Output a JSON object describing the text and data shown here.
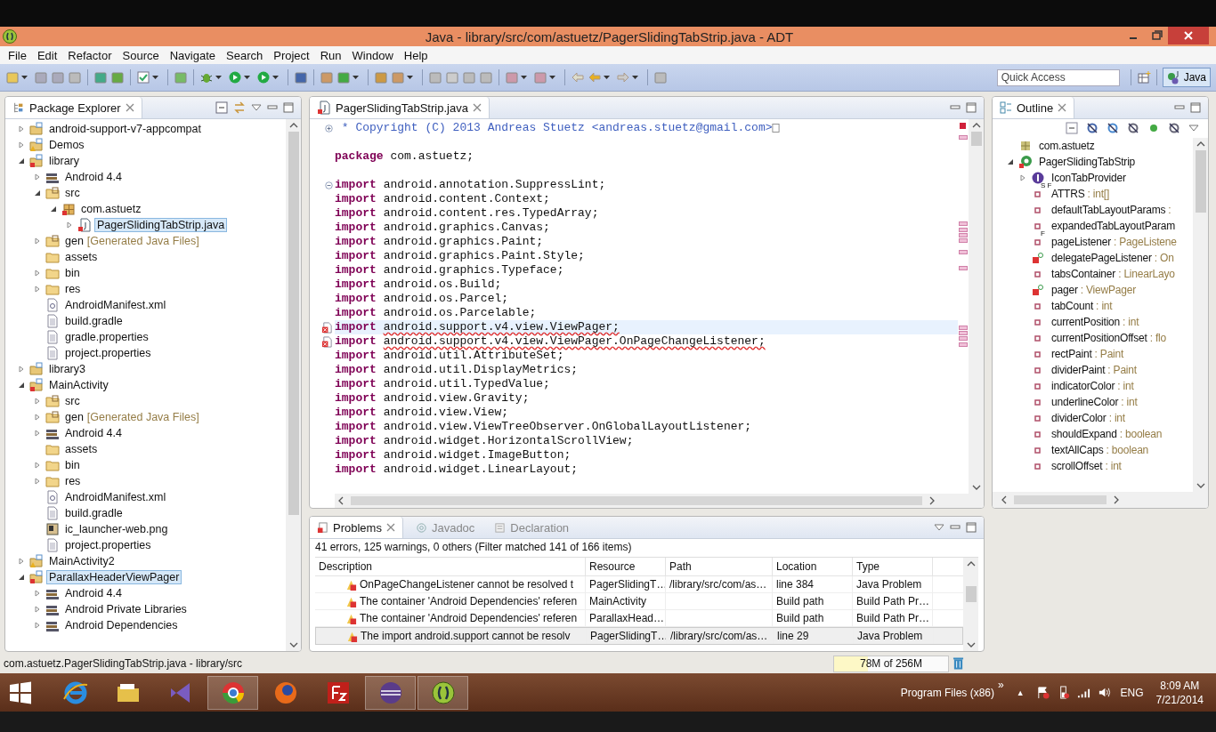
{
  "window": {
    "title": "Java - library/src/com/astuetz/PagerSlidingTabStrip.java - ADT"
  },
  "menu": [
    "File",
    "Edit",
    "Refactor",
    "Source",
    "Navigate",
    "Search",
    "Project",
    "Run",
    "Window",
    "Help"
  ],
  "quick_access": {
    "placeholder": "Quick Access"
  },
  "perspective": {
    "label": "Java",
    "selected": true
  },
  "package_explorer": {
    "title": "Package Explorer",
    "items": [
      {
        "label": "android-support-v7-appcompat",
        "kind": "project",
        "expanded": false,
        "selected": false
      },
      {
        "label": "Demos",
        "kind": "project-warn",
        "expanded": false,
        "selected": false
      },
      {
        "label": "library",
        "kind": "project-error",
        "expanded": true,
        "selected": false,
        "children": [
          {
            "label": "Android 4.4",
            "kind": "library",
            "expanded": false,
            "selected": false
          },
          {
            "label": "src",
            "kind": "source-folder",
            "expanded": true,
            "selected": false,
            "children": [
              {
                "label": "com.astuetz",
                "kind": "package",
                "expanded": true,
                "selected": false,
                "children": [
                  {
                    "label": "PagerSlidingTabStrip.java",
                    "kind": "java",
                    "expanded": false,
                    "selected": true
                  }
                ]
              }
            ]
          },
          {
            "label": "gen",
            "suffix": "[Generated Java Files]",
            "kind": "source-folder",
            "expanded": false,
            "selected": false
          },
          {
            "label": "assets",
            "kind": "folder",
            "selected": false
          },
          {
            "label": "bin",
            "kind": "folder",
            "expanded": false,
            "selected": false
          },
          {
            "label": "res",
            "kind": "folder",
            "expanded": false,
            "selected": false
          },
          {
            "label": "AndroidManifest.xml",
            "kind": "xml",
            "selected": false
          },
          {
            "label": "build.gradle",
            "kind": "file",
            "selected": false
          },
          {
            "label": "gradle.properties",
            "kind": "file",
            "selected": false
          },
          {
            "label": "project.properties",
            "kind": "file",
            "selected": false
          }
        ]
      },
      {
        "label": "library3",
        "kind": "project",
        "expanded": false,
        "selected": false
      },
      {
        "label": "MainActivity",
        "kind": "project-error",
        "expanded": true,
        "selected": false,
        "children": [
          {
            "label": "src",
            "kind": "source-folder",
            "expanded": false,
            "selected": false
          },
          {
            "label": "gen",
            "suffix": "[Generated Java Files]",
            "kind": "source-folder",
            "expanded": false,
            "selected": false
          },
          {
            "label": "Android 4.4",
            "kind": "library",
            "expanded": false,
            "selected": false
          },
          {
            "label": "assets",
            "kind": "folder",
            "selected": false
          },
          {
            "label": "bin",
            "kind": "folder",
            "expanded": false,
            "selected": false
          },
          {
            "label": "res",
            "kind": "folder",
            "expanded": false,
            "selected": false
          },
          {
            "label": "AndroidManifest.xml",
            "kind": "xml",
            "selected": false
          },
          {
            "label": "build.gradle",
            "kind": "file",
            "selected": false
          },
          {
            "label": "ic_launcher-web.png",
            "kind": "image",
            "selected": false
          },
          {
            "label": "project.properties",
            "kind": "file",
            "selected": false
          }
        ]
      },
      {
        "label": "MainActivity2",
        "kind": "project-warn",
        "expanded": false,
        "selected": false
      },
      {
        "label": "ParallaxHeaderViewPager",
        "kind": "project-error",
        "expanded": true,
        "selected": true,
        "children": [
          {
            "label": "Android 4.4",
            "kind": "library",
            "expanded": false,
            "selected": false
          },
          {
            "label": "Android Private Libraries",
            "kind": "library",
            "expanded": false,
            "selected": false
          },
          {
            "label": "Android Dependencies",
            "kind": "library",
            "expanded": false,
            "selected": false
          }
        ]
      }
    ]
  },
  "editor": {
    "tab": {
      "label": "PagerSlidingTabStrip.java"
    },
    "lines": [
      {
        "kind": "comment",
        "folded": true,
        "text": " * Copyright (C) 2013 Andreas Stuetz <andreas.stuetz@gmail.com>"
      },
      {
        "kind": "blank"
      },
      {
        "kind": "statement",
        "keyword": "package",
        "text": "com.astuetz;"
      },
      {
        "kind": "blank"
      },
      {
        "kind": "statement",
        "folded": false,
        "keyword": "import",
        "text": "android.annotation.SuppressLint;"
      },
      {
        "kind": "statement",
        "keyword": "import",
        "text": "android.content.Context;"
      },
      {
        "kind": "statement",
        "keyword": "import",
        "text": "android.content.res.TypedArray;"
      },
      {
        "kind": "statement",
        "keyword": "import",
        "text": "android.graphics.Canvas;"
      },
      {
        "kind": "statement",
        "keyword": "import",
        "text": "android.graphics.Paint;"
      },
      {
        "kind": "statement",
        "keyword": "import",
        "text": "android.graphics.Paint.Style;"
      },
      {
        "kind": "statement",
        "keyword": "import",
        "text": "android.graphics.Typeface;"
      },
      {
        "kind": "statement",
        "keyword": "import",
        "text": "android.os.Build;"
      },
      {
        "kind": "statement",
        "keyword": "import",
        "text": "android.os.Parcel;"
      },
      {
        "kind": "statement",
        "keyword": "import",
        "text": "android.os.Parcelable;"
      },
      {
        "kind": "statement",
        "keyword": "import",
        "text": "android.support.v4.view.ViewPager;",
        "error": true,
        "current": true
      },
      {
        "kind": "statement",
        "keyword": "import",
        "text": "android.support.v4.view.ViewPager.OnPageChangeListener;",
        "error": true
      },
      {
        "kind": "statement",
        "keyword": "import",
        "text": "android.util.AttributeSet;"
      },
      {
        "kind": "statement",
        "keyword": "import",
        "text": "android.util.DisplayMetrics;"
      },
      {
        "kind": "statement",
        "keyword": "import",
        "text": "android.util.TypedValue;"
      },
      {
        "kind": "statement",
        "keyword": "import",
        "text": "android.view.Gravity;"
      },
      {
        "kind": "statement",
        "keyword": "import",
        "text": "android.view.View;"
      },
      {
        "kind": "statement",
        "keyword": "import",
        "text": "android.view.ViewTreeObserver.OnGlobalLayoutListener;"
      },
      {
        "kind": "statement",
        "keyword": "import",
        "text": "android.widget.HorizontalScrollView;"
      },
      {
        "kind": "statement",
        "keyword": "import",
        "text": "android.widget.ImageButton;"
      },
      {
        "kind": "statement",
        "keyword": "import",
        "text": "android.widget.LinearLayout;"
      }
    ]
  },
  "outline": {
    "title": "Outline",
    "items": [
      {
        "name": "com.astuetz",
        "kind": "package"
      },
      {
        "name": "PagerSlidingTabStrip",
        "kind": "class",
        "expanded": true,
        "children": [
          {
            "name": "IconTabProvider",
            "kind": "interface",
            "expanded": false
          },
          {
            "name": "ATTRS",
            "type": ": int[]",
            "kind": "field",
            "decorator": "S F"
          },
          {
            "name": "defaultTabLayoutParams",
            "type": ":",
            "kind": "field"
          },
          {
            "name": "expandedTabLayoutParam",
            "kind": "field"
          },
          {
            "name": "pageListener",
            "type": ": PageListene",
            "kind": "field",
            "decorator": "F"
          },
          {
            "name": "delegatePageListener",
            "type": ": On",
            "kind": "field-error"
          },
          {
            "name": "tabsContainer",
            "type": ": LinearLayo",
            "kind": "field"
          },
          {
            "name": "pager",
            "type": ": ViewPager",
            "kind": "field-error"
          },
          {
            "name": "tabCount",
            "type": ": int",
            "kind": "field"
          },
          {
            "name": "currentPosition",
            "type": ": int",
            "kind": "field"
          },
          {
            "name": "currentPositionOffset",
            "type": ": flo",
            "kind": "field"
          },
          {
            "name": "rectPaint",
            "type": ": Paint",
            "kind": "field"
          },
          {
            "name": "dividerPaint",
            "type": ": Paint",
            "kind": "field"
          },
          {
            "name": "indicatorColor",
            "type": ": int",
            "kind": "field"
          },
          {
            "name": "underlineColor",
            "type": ": int",
            "kind": "field"
          },
          {
            "name": "dividerColor",
            "type": ": int",
            "kind": "field"
          },
          {
            "name": "shouldExpand",
            "type": ": boolean",
            "kind": "field"
          },
          {
            "name": "textAllCaps",
            "type": ": boolean",
            "kind": "field"
          },
          {
            "name": "scrollOffset",
            "type": ": int",
            "kind": "field"
          }
        ]
      }
    ]
  },
  "problems": {
    "tabs": [
      {
        "label": "Problems",
        "selected": true
      },
      {
        "label": "Javadoc",
        "selected": false
      },
      {
        "label": "Declaration",
        "selected": false
      }
    ],
    "summary": "41 errors, 125 warnings, 0 others (Filter matched 141 of 166 items)",
    "columns": [
      "Description",
      "Resource",
      "Path",
      "Location",
      "Type"
    ],
    "rows": [
      {
        "description": "OnPageChangeListener cannot be resolved t",
        "resource": "PagerSlidingT…",
        "path": "/library/src/com/as…",
        "location": "line 384",
        "type": "Java Problem",
        "selected": false
      },
      {
        "description": "The container 'Android Dependencies' referen",
        "resource": "MainActivity",
        "path": "",
        "location": "Build path",
        "type": "Build Path Pr…",
        "selected": false
      },
      {
        "description": "The container 'Android Dependencies' referen",
        "resource": "ParallaxHead…",
        "path": "",
        "location": "Build path",
        "type": "Build Path Pr…",
        "selected": false
      },
      {
        "description": "The import android.support cannot be resolv",
        "resource": "PagerSlidingT…",
        "path": "/library/src/com/as…",
        "location": "line 29",
        "type": "Java Problem",
        "selected": true
      }
    ]
  },
  "status_bar": {
    "text": "com.astuetz.PagerSlidingTabStrip.java - library/src",
    "heap": {
      "text": "78M of 256M",
      "level": 0.3
    }
  },
  "taskbar": {
    "apps": [
      {
        "kind": "ie",
        "selected": false
      },
      {
        "kind": "explorer",
        "selected": false
      },
      {
        "kind": "vs",
        "selected": false
      },
      {
        "kind": "chrome",
        "selected": true
      },
      {
        "kind": "firefox",
        "selected": false
      },
      {
        "kind": "filezilla",
        "selected": false
      },
      {
        "kind": "eclipse",
        "selected": true
      },
      {
        "kind": "adt",
        "selected": true
      }
    ],
    "toolbar_label": "Program Files (x86)",
    "chevron": "»",
    "tray_arrow": "▲",
    "language": "ENG",
    "time": "8:09 AM",
    "date": "7/21/2014"
  }
}
